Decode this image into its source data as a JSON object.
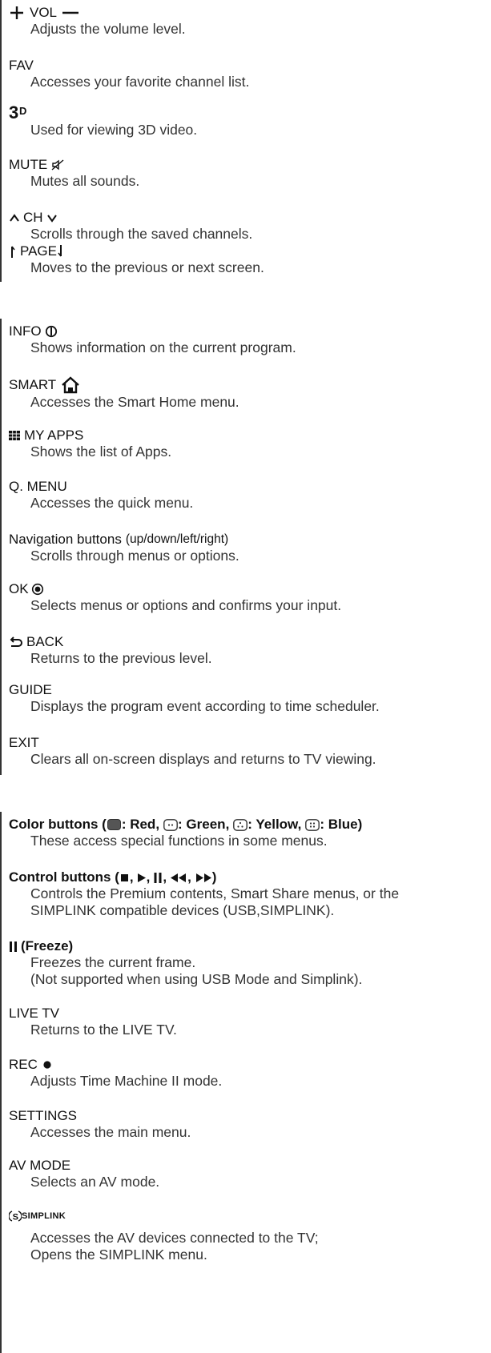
{
  "entries": [
    {
      "title": "VOL",
      "desc": "Adjusts the volume level."
    },
    {
      "title": "FAV",
      "desc": "Accesses your favorite channel list."
    },
    {
      "title": "3D",
      "desc": "Used for viewing 3D video."
    },
    {
      "title": "MUTE",
      "desc": "Mutes all sounds."
    },
    {
      "title": "CH",
      "desc": "Scrolls through the saved channels."
    },
    {
      "title": "PAGE",
      "desc": "Moves to the previous or next screen."
    },
    {
      "title": "INFO",
      "desc": "Shows information on the current program."
    },
    {
      "title": "SMART",
      "desc": "Accesses the Smart Home menu."
    },
    {
      "title": "MY APPS",
      "desc": "Shows the list of Apps."
    },
    {
      "title": "Q. MENU",
      "desc": "Accesses the quick menu."
    },
    {
      "title": "Navigation buttons",
      "subtitle": "(up/down/left/right)",
      "desc": "Scrolls through menus or options."
    },
    {
      "title": "OK",
      "desc": "Selects menus or options and confirms your input."
    },
    {
      "title": "BACK",
      "desc": "Returns to the previous level."
    },
    {
      "title": "GUIDE",
      "desc": "Displays the program event according to time scheduler."
    },
    {
      "title": "EXIT",
      "desc": "Clears all on-screen displays and returns to TV viewing."
    },
    {
      "title": "Color buttons (",
      "red": ": Red,",
      "green": ": Green,",
      "yellow": ": Yellow,",
      "blue": ": Blue)",
      "desc": "These access special functions in some menus."
    },
    {
      "title": "Control buttons (",
      "comma": ",",
      "close": ")",
      "desc": "Controls the Premium contents, Smart Share menus, or the",
      "desc2": "SIMPLINK compatible devices (USB,SIMPLINK)."
    },
    {
      "title": "(Freeze)",
      "desc": "Freezes the current frame.",
      "desc2": "(Not supported when using USB Mode and Simplink)."
    },
    {
      "title": "LIVE TV",
      "desc": "Returns to the LIVE TV."
    },
    {
      "title": "REC",
      "desc": "Adjusts Time Machine II mode."
    },
    {
      "title": "SETTINGS",
      "desc": "Accesses the main menu."
    },
    {
      "title": "AV MODE",
      "desc": "Selects an AV mode."
    },
    {
      "title": "SIMPLINK",
      "desc": "Accesses the AV devices connected to the TV;",
      "desc2": "Opens the SIMPLINK menu."
    }
  ]
}
